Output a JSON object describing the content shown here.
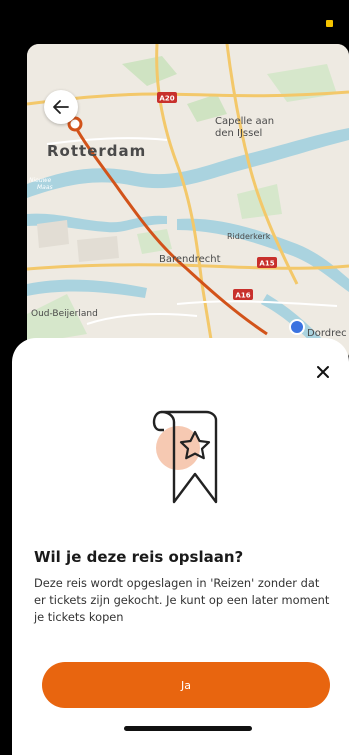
{
  "status": {
    "indicator_color": "#f5c400"
  },
  "map": {
    "labels": {
      "rotterdam": "Rotterdam",
      "capelle_line1": "Capelle aan",
      "capelle_line2": "den IJssel",
      "nieuwe_line1": "Nieuwe",
      "nieuwe_line2": "Maas",
      "ridderkerk": "Ridderkerk",
      "barendrecht": "Barendrecht",
      "oud_beijerland": "Oud-Beijerland",
      "dordrecht": "Dordrec"
    },
    "road_shields": {
      "a20": "A20",
      "a15": "A15",
      "a16": "A16"
    },
    "route_color": "#d2531a"
  },
  "navigation": {
    "back_icon": "arrow-left-icon"
  },
  "sheet": {
    "close_icon": "close-icon",
    "illustration_icon": "bookmark-star-icon",
    "title": "Wil je deze reis opslaan?",
    "body": "Deze reis wordt opgeslagen in 'Reizen' zonder dat er tickets zijn gekocht. Je kunt op een later moment je tickets kopen",
    "confirm_label": "Ja",
    "accent_color": "#e8650f"
  }
}
